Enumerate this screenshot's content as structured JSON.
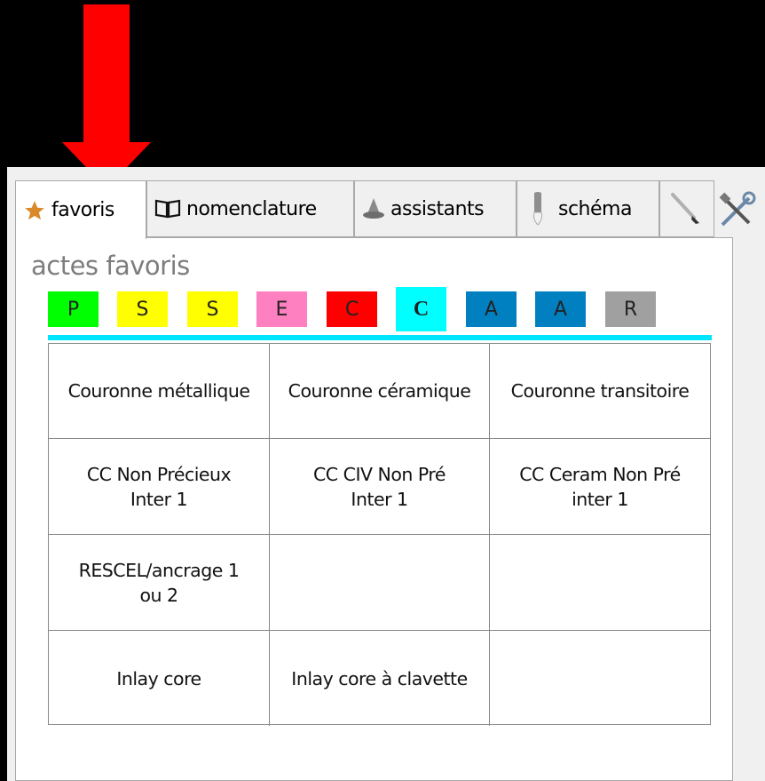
{
  "tabs": [
    {
      "label": "favoris",
      "icon": "star-icon",
      "active": true
    },
    {
      "label": "nomenclature",
      "icon": "book-icon",
      "active": false
    },
    {
      "label": "assistants",
      "icon": "wizard-hat-icon",
      "active": false
    },
    {
      "label": "schéma",
      "icon": "tooth-icon",
      "active": false
    },
    {
      "label": "",
      "icon": "brush-icon",
      "active": false
    }
  ],
  "toolbar": {
    "tools_icon": "tools-icon"
  },
  "section": {
    "title": "actes favoris"
  },
  "categories": [
    {
      "label": "P",
      "color": "#00ff00"
    },
    {
      "label": "S",
      "color": "#ffff00"
    },
    {
      "label": "S",
      "color": "#ffff00"
    },
    {
      "label": "E",
      "color": "#ff80c0"
    },
    {
      "label": "C",
      "color": "#ff0000"
    },
    {
      "label": "C",
      "color": "#00ffff",
      "active": true
    },
    {
      "label": "A",
      "color": "#0080c0"
    },
    {
      "label": "A",
      "color": "#0080c0"
    },
    {
      "label": "R",
      "color": "#a0a0a0"
    }
  ],
  "favorites": [
    [
      "Couronne métallique",
      "Couronne céramique",
      "Couronne transitoire"
    ],
    [
      "CC Non Précieux\nInter 1",
      "CC CIV Non Pré\nInter 1",
      "CC Ceram Non Pré\ninter 1"
    ],
    [
      "RESCEL/ancrage 1\nou 2",
      "",
      ""
    ],
    [
      "Inlay core",
      "Inlay core à clavette",
      ""
    ]
  ],
  "colors": {
    "accent_arrow": "#ff0000",
    "active_line": "#00e5ff"
  }
}
